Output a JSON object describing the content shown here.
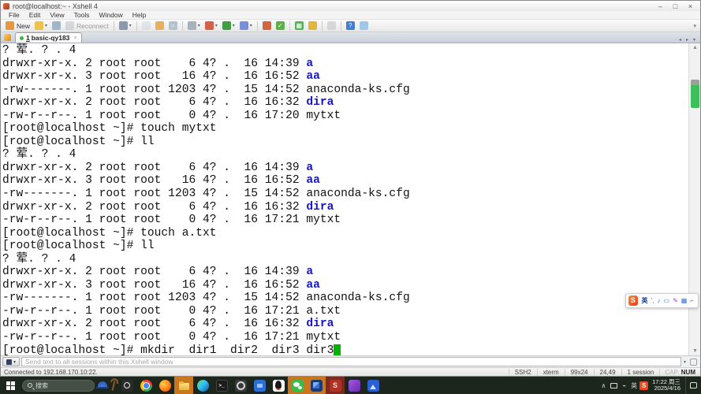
{
  "window": {
    "title": "root@localhost:~ - Xshell 4",
    "controls": {
      "minimize": "–",
      "maximize": "□",
      "close": "×"
    }
  },
  "menubar": {
    "items": [
      "File",
      "Edit",
      "View",
      "Tools",
      "Window",
      "Help"
    ]
  },
  "toolbar": {
    "items": [
      {
        "name": "new-session-button",
        "color": "#e8973a",
        "label": "New"
      },
      {
        "name": "open-session-dropdown",
        "color": "#ecc24a",
        "dropdown": true
      },
      {
        "name": "connect-icon",
        "color": "#9fb6c9"
      },
      {
        "name": "reconnect-button",
        "color": "#b0b8c0",
        "label": "Reconnect",
        "disabled": true
      },
      {
        "sep": true
      },
      {
        "name": "session-manager-dropdown",
        "color": "#8a9ab0",
        "dropdown": true
      },
      {
        "sep": true
      },
      {
        "name": "copy-icon",
        "color": "#cdd3da",
        "disabled": true
      },
      {
        "name": "paste-icon",
        "color": "#e8b05a"
      },
      {
        "name": "find-icon",
        "color": "#b4c2ce",
        "glyph": "○"
      },
      {
        "sep": true
      },
      {
        "name": "print-dropdown",
        "color": "#a9b2ba",
        "dropdown": true
      },
      {
        "name": "properties-dropdown",
        "color": "#d4604a",
        "dropdown": true
      },
      {
        "name": "web-dropdown",
        "color": "#3f9e43",
        "dropdown": true
      },
      {
        "name": "transfer-dropdown",
        "color": "#7a8fd4",
        "dropdown": true
      },
      {
        "sep": true
      },
      {
        "name": "ftp-icon",
        "color": "#d4663c"
      },
      {
        "name": "secure-check-icon",
        "color": "#5fae4a",
        "glyph": "✓"
      },
      {
        "sep": true
      },
      {
        "name": "apps-grid-icon",
        "color": "#56b056",
        "glyph": "▦"
      },
      {
        "name": "lock-icon",
        "color": "#e0b63c"
      },
      {
        "sep": true
      },
      {
        "name": "snapshot-icon",
        "color": "#b8b8b8",
        "disabled": true
      },
      {
        "sep": true
      },
      {
        "name": "help-icon",
        "color": "#3c7fd4",
        "glyph": "?"
      },
      {
        "name": "feedback-icon",
        "color": "#9fc7e8"
      }
    ],
    "overflow_arrow": "▾"
  },
  "tabbar": {
    "tab_number": "1",
    "tab_label": "basic-qy183",
    "tab_close": "×"
  },
  "terminal": {
    "lines": [
      {
        "s": [
          {
            "t": "? 荤. ? . 4"
          }
        ]
      },
      {
        "s": [
          {
            "t": "drwxr-xr-x. 2 root root    6 4? .  16 14:39 "
          },
          {
            "t": "a",
            "c": "d"
          }
        ]
      },
      {
        "s": [
          {
            "t": "drwxr-xr-x. 3 root root   16 4? .  16 16:52 "
          },
          {
            "t": "aa",
            "c": "d"
          }
        ]
      },
      {
        "s": [
          {
            "t": "-rw-------. 1 root root 1203 4? .  15 14:52 anaconda-ks.cfg"
          }
        ]
      },
      {
        "s": [
          {
            "t": "drwxr-xr-x. 2 root root    6 4? .  16 16:32 "
          },
          {
            "t": "dira",
            "c": "d"
          }
        ]
      },
      {
        "s": [
          {
            "t": "-rw-r--r--. 1 root root    0 4? .  16 17:20 mytxt"
          }
        ]
      },
      {
        "s": [
          {
            "t": "[root@localhost ~]# touch mytxt"
          }
        ]
      },
      {
        "s": [
          {
            "t": "[root@localhost ~]# ll"
          }
        ]
      },
      {
        "s": [
          {
            "t": "? 荤. ? . 4"
          }
        ]
      },
      {
        "s": [
          {
            "t": "drwxr-xr-x. 2 root root    6 4? .  16 14:39 "
          },
          {
            "t": "a",
            "c": "d"
          }
        ]
      },
      {
        "s": [
          {
            "t": "drwxr-xr-x. 3 root root   16 4? .  16 16:52 "
          },
          {
            "t": "aa",
            "c": "d"
          }
        ]
      },
      {
        "s": [
          {
            "t": "-rw-------. 1 root root 1203 4? .  15 14:52 anaconda-ks.cfg"
          }
        ]
      },
      {
        "s": [
          {
            "t": "drwxr-xr-x. 2 root root    6 4? .  16 16:32 "
          },
          {
            "t": "dira",
            "c": "d"
          }
        ]
      },
      {
        "s": [
          {
            "t": "-rw-r--r--. 1 root root    0 4? .  16 17:21 mytxt"
          }
        ]
      },
      {
        "s": [
          {
            "t": "[root@localhost ~]# touch a.txt"
          }
        ]
      },
      {
        "s": [
          {
            "t": "[root@localhost ~]# ll"
          }
        ]
      },
      {
        "s": [
          {
            "t": "? 荤. ? . 4"
          }
        ]
      },
      {
        "s": [
          {
            "t": "drwxr-xr-x. 2 root root    6 4? .  16 14:39 "
          },
          {
            "t": "a",
            "c": "d"
          }
        ]
      },
      {
        "s": [
          {
            "t": "drwxr-xr-x. 3 root root   16 4? .  16 16:52 "
          },
          {
            "t": "aa",
            "c": "d"
          }
        ]
      },
      {
        "s": [
          {
            "t": "-rw-------. 1 root root 1203 4? .  15 14:52 anaconda-ks.cfg"
          }
        ]
      },
      {
        "s": [
          {
            "t": "-rw-r--r--. 1 root root    0 4? .  16 17:21 a.txt"
          }
        ]
      },
      {
        "s": [
          {
            "t": "drwxr-xr-x. 2 root root    6 4? .  16 16:32 "
          },
          {
            "t": "dira",
            "c": "d"
          }
        ]
      },
      {
        "s": [
          {
            "t": "-rw-r--r--. 1 root root    0 4? .  16 17:21 mytxt"
          }
        ]
      },
      {
        "s": [
          {
            "t": "[root@localhost ~]# mkdir  dir1  dir2  dir3 dir3"
          }
        ],
        "cursor": true
      }
    ]
  },
  "sendbar": {
    "placeholder": "Send text to all sessions within this Xshell window"
  },
  "statusbar": {
    "connection": "Connected to 192.168.170.10:22.",
    "cells": [
      "SSH2",
      "xterm",
      "99x24",
      "24,49",
      "1 session"
    ],
    "caps": "CAP",
    "num": "NUM"
  },
  "taskbar": {
    "search_label": "搜索",
    "apps": [
      {
        "name": "taskbar-magnifier-icon",
        "style": "mag-dark"
      },
      {
        "name": "taskbar-chrome-icon",
        "style": "chrome"
      },
      {
        "name": "taskbar-firefox-icon",
        "style": "firefox"
      },
      {
        "name": "taskbar-explorer-icon",
        "style": "explorer",
        "cell": "#c9761f"
      },
      {
        "name": "taskbar-edge-icon",
        "style": "edge"
      },
      {
        "name": "taskbar-terminal-icon",
        "style": "cmd",
        "glyph": ">_"
      },
      {
        "name": "taskbar-settings-icon",
        "style": "gear"
      },
      {
        "name": "taskbar-media-icon",
        "style": "media"
      },
      {
        "name": "taskbar-qq-icon",
        "style": "qq"
      },
      {
        "name": "taskbar-wechat-icon",
        "style": "wechat",
        "cell": "#c9761f"
      },
      {
        "name": "taskbar-projector-icon",
        "style": "proj",
        "cell": "#c9761f"
      },
      {
        "name": "taskbar-xshell-icon",
        "style": "xshell",
        "glyph": "S",
        "cell": "#7a2a20"
      },
      {
        "name": "taskbar-purple-app-icon",
        "style": "purple"
      },
      {
        "name": "taskbar-blue-app-icon",
        "style": "bluemt"
      }
    ],
    "tray_expand": "∧",
    "tray_ime_mode": "英",
    "tray_sogou": "S",
    "clock_time": "17:22 周三",
    "clock_date": "2025/4/16"
  },
  "ime_bar": {
    "logo": "S",
    "mode": "英",
    "icons": [
      {
        "name": "ime-quote-icon",
        "glyph": "’,",
        "color": "#3a6fd8"
      },
      {
        "name": "ime-mic-icon",
        "glyph": "♪",
        "color": "#3a6fd8"
      },
      {
        "name": "ime-keyboard-icon",
        "glyph": "▭",
        "color": "#3a6fd8"
      },
      {
        "name": "ime-brush-icon",
        "glyph": "✎",
        "color": "#8a4fd4"
      },
      {
        "name": "ime-toolbox-icon",
        "glyph": "▦",
        "color": "#3a6fd8"
      },
      {
        "name": "ime-wrench-icon",
        "glyph": "⌐",
        "color": "#b05a2a"
      }
    ]
  }
}
